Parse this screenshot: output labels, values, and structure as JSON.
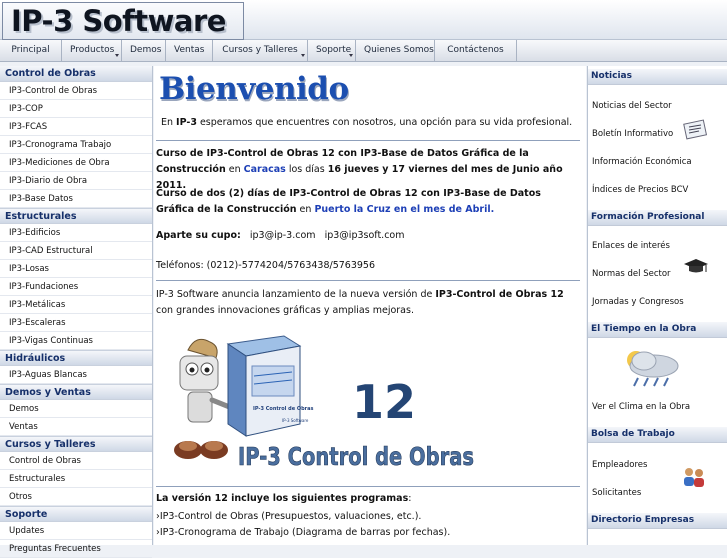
{
  "site": {
    "logo_text": "IP-3 Software"
  },
  "nav": [
    {
      "label": "Principal",
      "dropdown": false
    },
    {
      "label": "Productos",
      "dropdown": true
    },
    {
      "label": "Demos",
      "dropdown": false
    },
    {
      "label": "Ventas",
      "dropdown": false
    },
    {
      "label": "Cursos y Talleres",
      "dropdown": true
    },
    {
      "label": "Soporte",
      "dropdown": true
    },
    {
      "label": "Quienes Somos",
      "dropdown": false
    },
    {
      "label": "Contáctenos",
      "dropdown": false
    }
  ],
  "left": {
    "sections": [
      {
        "title": "Control de Obras",
        "items": [
          "IP3-Control de Obras",
          "IP3-COP",
          "IP3-FCAS",
          "IP3-Cronograma Trabajo",
          "IP3-Mediciones de Obra",
          "IP3-Diario de Obra",
          "IP3-Base Datos"
        ]
      },
      {
        "title": "Estructurales",
        "items": [
          "IP3-Edificios",
          "IP3-CAD Estructural",
          "IP3-Losas",
          "IP3-Fundaciones",
          "IP3-Metálicas",
          "IP3-Escaleras",
          "IP3-Vigas Continuas"
        ]
      },
      {
        "title": "Hidráulicos",
        "items": [
          "IP3-Aguas Blancas"
        ]
      },
      {
        "title": "Demos y Ventas",
        "items": [
          "Demos",
          "Ventas"
        ]
      },
      {
        "title": "Cursos y Talleres",
        "items": [
          "Control de Obras",
          "Estructurales",
          "Otros"
        ]
      },
      {
        "title": "Soporte",
        "items": [
          "Updates",
          "Preguntas Frecuentes"
        ]
      }
    ]
  },
  "main": {
    "heading": "Bienvenido",
    "intro": {
      "pre": "En ",
      "brand": "IP-3",
      "post": " esperamos que encuentres con nosotros, una opción para su vida profesional."
    },
    "course1": {
      "title": "Curso de IP3-Control de Obras 12 con IP3-Base de Datos Gráfica de la Construcción",
      "en": " en ",
      "city": "Caracas",
      "dias": " los días ",
      "dates": "16 jueves y 17 viernes del mes de Junio año 2011."
    },
    "course2": {
      "title": "Curso de dos (2) días de IP3-Control de Obras 12 con IP3-Base de Datos Gráfica de la Construcción",
      "en": " en ",
      "place": "Puerto la Cruz en el mes de Abril."
    },
    "cupo": {
      "label": "Aparte su cupo:",
      "email1": "ip3@ip-3.com",
      "email2": "ip3@ip3soft.com"
    },
    "phones": "Teléfonos: (0212)-5774204/5763438/5763956",
    "announce": {
      "pre": "IP-3 Software anuncia lanzamiento de la nueva versión de ",
      "product": "IP3-Control de Obras 12",
      "post": " con grandes innovaciones gráficas y amplias mejoras."
    },
    "image": {
      "version": "12",
      "caption": "IP-3 Control de Obras",
      "box_label": "IP-3 Control de Obras",
      "box_brand": "IP-3 Software"
    },
    "programs": {
      "pre": "La versión 12 incluye los siguientes programas",
      "colon": ":",
      "items": [
        "IP3-Control de Obras (Presupuestos, valuaciones, etc.).",
        "IP3-Cronograma de Trabajo (Diagrama de barras por fechas)."
      ]
    }
  },
  "right": {
    "news": {
      "title": "Noticias",
      "items": [
        "Noticias del Sector",
        "Boletín Informativo",
        "Información Económica",
        "Índices de Precios BCV"
      ]
    },
    "training": {
      "title": "Formación Profesional",
      "items": [
        "Enlaces de interés",
        "Normas del Sector",
        "Jornadas y Congresos"
      ]
    },
    "weather": {
      "title": "El Tiempo en la Obra",
      "link": "Ver el Clima en la Obra"
    },
    "jobs": {
      "title": "Bolsa de Trabajo",
      "items": [
        "Empleadores",
        "Solicitantes"
      ]
    },
    "directory": {
      "title": "Directorio Empresas"
    }
  }
}
